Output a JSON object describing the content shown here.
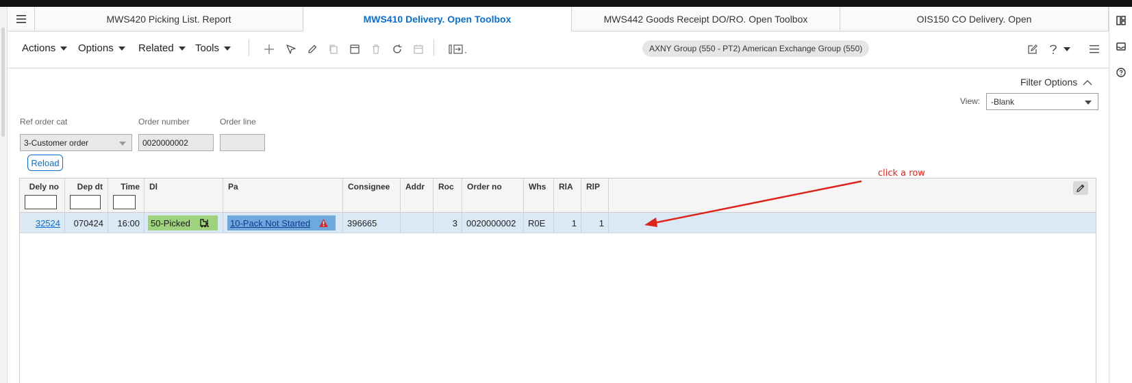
{
  "tabs": [
    {
      "label": "MWS420 Picking List. Report",
      "active": false
    },
    {
      "label": "MWS410 Delivery. Open Toolbox",
      "active": true
    },
    {
      "label": "MWS442 Goods Receipt DO/RO. Open Toolbox",
      "active": false
    },
    {
      "label": "OIS150 CO Delivery. Open",
      "active": false
    }
  ],
  "toolbar": {
    "actions": "Actions",
    "options": "Options",
    "related": "Related",
    "tools": "Tools",
    "company": "AXNY Group (550 - PT2) American Exchange Group (550)"
  },
  "filter": {
    "toggle_label": "Filter Options",
    "view_label": "View:",
    "view_value": "-Blank"
  },
  "fields": {
    "ref_order_cat_label": "Ref order cat",
    "ref_order_cat_value": "3-Customer order",
    "order_number_label": "Order number",
    "order_number_value": "0020000002",
    "order_line_label": "Order line",
    "order_line_value": ""
  },
  "reload_label": "Reload",
  "grid": {
    "columns": [
      "Dely no",
      "Dep dt",
      "Time",
      "Dl",
      "Pa",
      "Consignee",
      "Addr",
      "Roc",
      "Order no",
      "Whs",
      "RlA",
      "RlP"
    ],
    "rows": [
      {
        "dely_no": "32524",
        "dep_dt": "070424",
        "time": "16:00",
        "dl": "50-Picked",
        "pa": "10-Pack Not Started",
        "consignee": "396665",
        "addr": "",
        "roc": "3",
        "order_no": "0020000002",
        "whs": "R0E",
        "rla": "1",
        "rlp": "1"
      }
    ]
  },
  "annotation": {
    "text": "click a row",
    "color": "#e0241b"
  },
  "colors": {
    "accent": "#0a6ed1",
    "row_selected": "#dbe8f6",
    "status_picked": "#9ed27d",
    "status_pack": "#6fa8dc",
    "warning": "#d32f2f"
  },
  "icons": {
    "menu": "hamburger-icon",
    "add": "plus-icon",
    "select": "pointer-icon",
    "edit": "pencil-icon",
    "copy": "copy-icon",
    "display": "display-icon",
    "delete": "trash-icon",
    "refresh": "refresh-icon",
    "calendar": "calendar-icon",
    "related_option": "bracket-arrow-icon",
    "personalize": "edit-square-icon",
    "help": "help-icon",
    "more": "hamburger-icon",
    "forklift": "forklift-icon",
    "warning": "warning-icon"
  }
}
